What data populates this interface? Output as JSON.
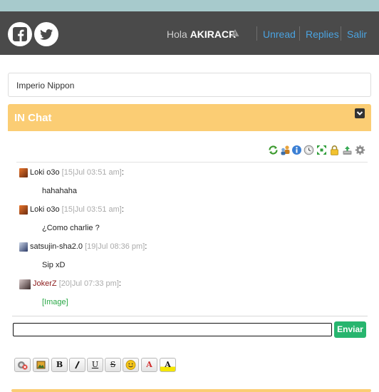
{
  "header": {
    "social": [
      {
        "name": "facebook-icon"
      },
      {
        "name": "twitter-icon"
      }
    ],
    "greeting": "Hola",
    "username": "AKIRACR",
    "nav": {
      "unread": "Unread",
      "replies": "Replies",
      "logout": "Salir"
    },
    "link_color": "#4aa3e0",
    "bg_color": "#4a4a4a"
  },
  "forum": {
    "name": "Imperio Nippon"
  },
  "chat": {
    "title": "IN Chat",
    "accent_color": "#fbcd74",
    "toolbar_icons": [
      "refresh-icon",
      "users-icon",
      "info-icon",
      "history-icon",
      "expand-icon",
      "lock-icon",
      "archive-icon",
      "settings-icon"
    ],
    "messages": [
      {
        "user": "Loki o3o",
        "meta": "[15|Jul 03:51 am]",
        "text": "hahahaha"
      },
      {
        "user": "Loki o3o",
        "meta": "[15|Jul 03:51 am]",
        "text": "¿Como charlie ?"
      },
      {
        "user": "satsujin-sha2.0",
        "meta": "[19|Jul 08:36 pm]",
        "text": "Sip xD"
      },
      {
        "user": "JokerZ",
        "meta": "[20|Jul 07:33 pm]",
        "text": "[Image]",
        "user_color": "#8b1a1a"
      }
    ],
    "input": {
      "value": "",
      "placeholder": ""
    },
    "send_label": "Enviar",
    "format_buttons": [
      {
        "name": "clear-format-button"
      },
      {
        "name": "insert-image-button"
      },
      {
        "name": "bold-button",
        "label": "B"
      },
      {
        "name": "italic-button",
        "label": "I"
      },
      {
        "name": "underline-button",
        "label": "U"
      },
      {
        "name": "strikethrough-button",
        "label": "S"
      },
      {
        "name": "emoji-button"
      },
      {
        "name": "font-color-button",
        "label": "A"
      },
      {
        "name": "highlight-color-button",
        "label": "A"
      }
    ]
  }
}
